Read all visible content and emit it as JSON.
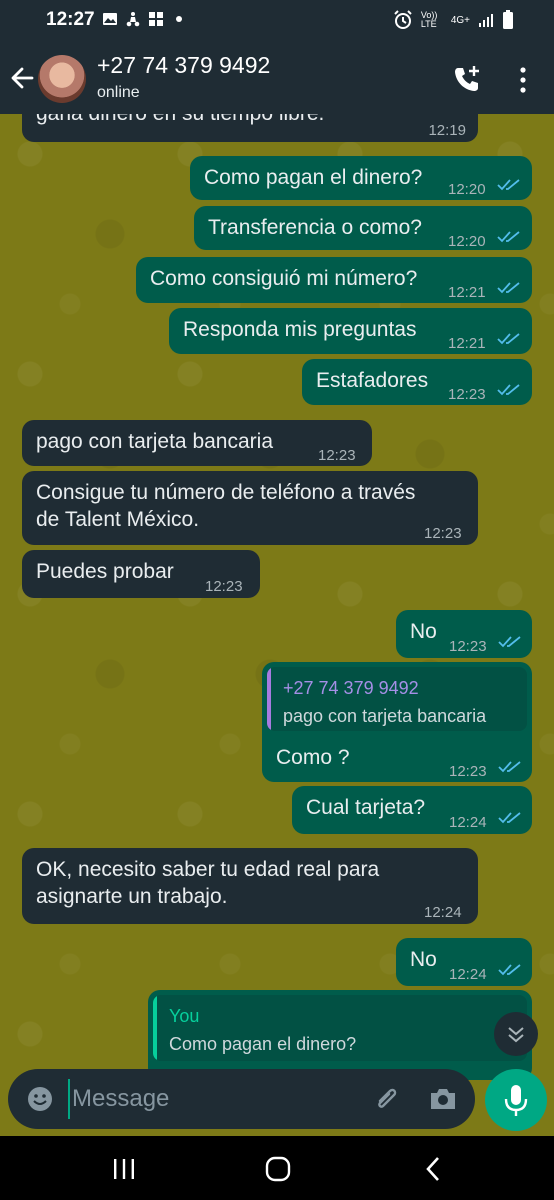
{
  "status_bar": {
    "time": "12:27",
    "icons": [
      "gallery-icon",
      "scooter-icon",
      "windows-icon",
      "dot-icon"
    ],
    "right_icons": [
      "alarm-icon",
      "volte-icon",
      "network-4g-icon",
      "signal-icon",
      "battery-icon"
    ],
    "volte_label": "Vo)) LTE",
    "network_label": "4G+"
  },
  "header": {
    "contact_name": "+27 74 379 9492",
    "status": "online"
  },
  "colors": {
    "header_bg": "#1f2c34",
    "chat_bg": "#7d7a17",
    "incoming_bubble": "#1f2c34",
    "outgoing_bubble": "#005c4b",
    "accent": "#00a884",
    "read_check": "#53bdeb"
  },
  "messages": [
    {
      "dir": "in",
      "text": "gana dinero en su tiempo libre.",
      "time": "12:19"
    },
    {
      "dir": "out",
      "text": "Como pagan el dinero?",
      "time": "12:20",
      "read": true
    },
    {
      "dir": "out",
      "text": "Transferencia o como?",
      "time": "12:20",
      "read": true
    },
    {
      "dir": "out",
      "text": "Como consiguió mi número?",
      "time": "12:21",
      "read": true
    },
    {
      "dir": "out",
      "text": "Responda mis preguntas",
      "time": "12:21",
      "read": true
    },
    {
      "dir": "out",
      "text": "Estafadores",
      "time": "12:23",
      "read": true
    },
    {
      "dir": "in",
      "text": "pago con tarjeta bancaria",
      "time": "12:23"
    },
    {
      "dir": "in",
      "text": "Consigue tu número de teléfono a través\nde Talent México.",
      "time": "12:23"
    },
    {
      "dir": "in",
      "text": "Puedes probar",
      "time": "12:23"
    },
    {
      "dir": "out",
      "text": "No",
      "time": "12:23",
      "read": true
    },
    {
      "dir": "out",
      "text": "Como ?",
      "time": "12:23",
      "read": true,
      "quote": {
        "name": "+27 74 379 9492",
        "text": "pago con tarjeta bancaria"
      }
    },
    {
      "dir": "out",
      "text": "Cual tarjeta?",
      "time": "12:24",
      "read": true
    },
    {
      "dir": "in",
      "text": "OK, necesito saber tu edad real para\nasignarte un trabajo.",
      "time": "12:24"
    },
    {
      "dir": "out",
      "text": "No",
      "time": "12:24",
      "read": true
    },
    {
      "dir": "out",
      "text": "",
      "time": "",
      "quote": {
        "name": "You",
        "text": "Como pagan el dinero?"
      }
    }
  ],
  "composer": {
    "placeholder": "Message"
  }
}
